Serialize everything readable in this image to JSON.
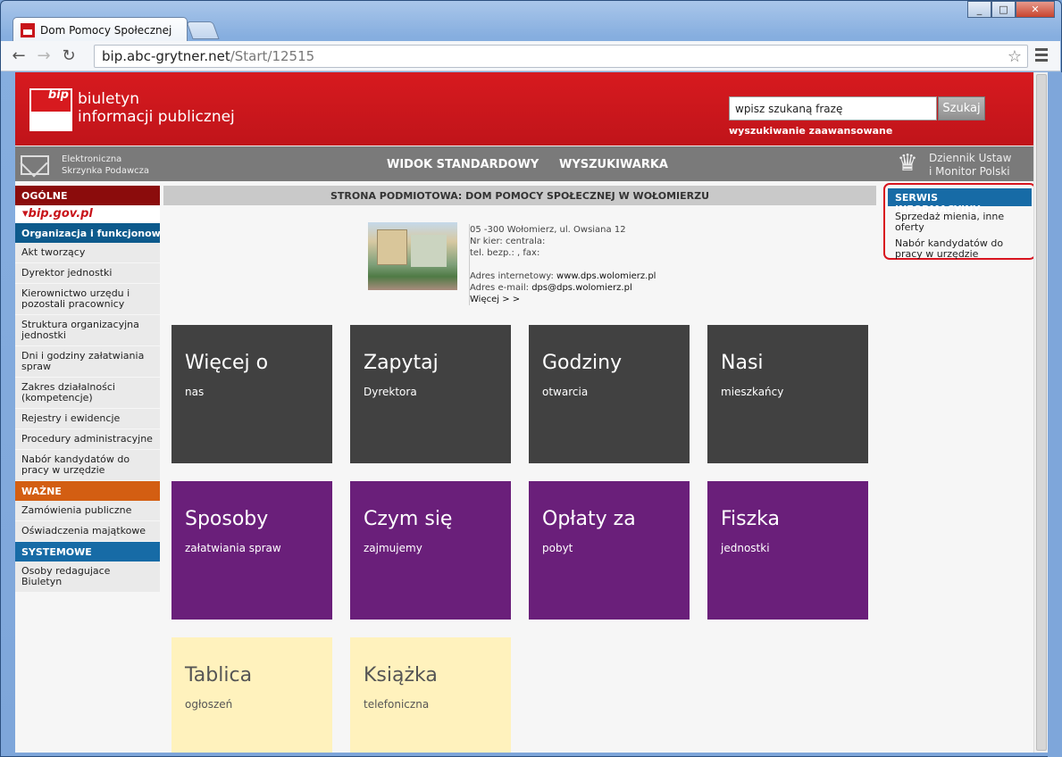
{
  "browser": {
    "tab_title": "Dom Pomocy Społecznej",
    "url_host": "bip.abc-grytner.net",
    "url_path": "/Start/12515"
  },
  "header": {
    "logo_mark": "bip",
    "logo_line1": "biuletyn",
    "logo_line2": "informacji publicznej",
    "search_value": "wpisz szukaną frazę",
    "search_button": "Szukaj",
    "advanced_search": "wyszukiwanie zaawansowane"
  },
  "topnav": {
    "epuap_line1": "Elektroniczna",
    "epuap_line2": "Skrzynka Podawcza",
    "items": [
      "WIDOK STANDARDOWY",
      "WYSZUKIWARKA"
    ],
    "dz_line1": "Dziennik Ustaw",
    "dz_line2": "i Monitor Polski"
  },
  "sidebar": {
    "general_header": "OGÓLNE",
    "bip_gov": "bip.gov.pl",
    "highlight": "Organizacja i funkcjonowanie",
    "items": [
      "Akt tworzący",
      "Dyrektor jednostki",
      "Kierownictwo urzędu i pozostali pracownicy",
      "Struktura organizacyjna jednostki",
      "Dni i godziny załatwiania spraw",
      "Zakres działalności (kompetencje)",
      "Rejestry i ewidencje",
      "Procedury administracyjne",
      "Nabór kandydatów do pracy w urzędzie"
    ],
    "important_header": "WAŻNE",
    "important_items": [
      "Zamówienia publiczne",
      "Oświadczenia majątkowe"
    ],
    "system_header": "SYSTEMOWE",
    "system_items": [
      "Osoby redagujace Biuletyn"
    ]
  },
  "main": {
    "title": "STRONA PODMIOTOWA: DOM POMOCY SPOŁECZNEJ W WOŁOMIERZU",
    "address": "05 -300 Wołomierz, ul. Owsiana 12",
    "phone_main": "Nr kier: centrala:",
    "phone_free": "tel. bezp.: , fax:",
    "web_label": "Adres internetowy:",
    "web": "www.dps.wolomierz.pl",
    "email_label": "Adres e-mail:",
    "email": "dps@dps.wolomierz.pl",
    "more": "Więcej > >",
    "tiles": [
      {
        "title": "Więcej o",
        "sub": "nas"
      },
      {
        "title": "Zapytaj",
        "sub": "Dyrektora"
      },
      {
        "title": "Godziny",
        "sub": "otwarcia"
      },
      {
        "title": "Nasi",
        "sub": "mieszkańcy"
      },
      {
        "title": "Sposoby",
        "sub": "załatwiania spraw"
      },
      {
        "title": "Czym się",
        "sub": "zajmujemy"
      },
      {
        "title": "Opłaty za",
        "sub": "pobyt"
      },
      {
        "title": "Fiszka",
        "sub": "jednostki"
      },
      {
        "title": "Tablica",
        "sub": "ogłoszeń"
      },
      {
        "title": "Książka",
        "sub": "telefoniczna"
      }
    ]
  },
  "right": {
    "header": "SERWIS INFORMACYJNY",
    "items": [
      "Sprzedaż mienia, inne oferty",
      "Nabór kandydatów do pracy w urzędzie"
    ]
  }
}
